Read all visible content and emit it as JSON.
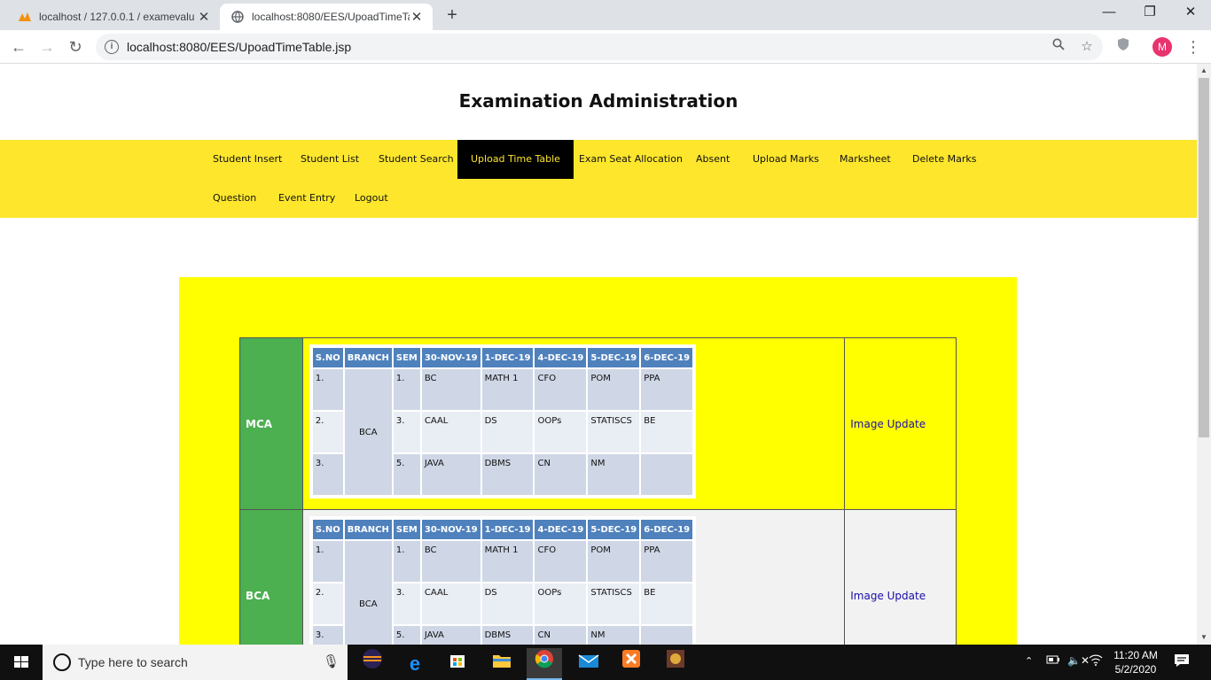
{
  "browser": {
    "tabs": [
      {
        "title": "localhost / 127.0.0.1 / examevalu",
        "favicon": "phpmyadmin-icon"
      },
      {
        "title": "localhost:8080/EES/UpoadTimeTa",
        "favicon": "globe-icon"
      }
    ],
    "url": "localhost:8080/EES/UpoadTimeTable.jsp",
    "profile_initial": "M"
  },
  "page": {
    "title": "Examination Administration",
    "nav": [
      "Student Insert",
      "Student List",
      "Student Search",
      "Upload Time Table",
      "Exam Seat Allocation",
      "Absent",
      "Upload Marks",
      "Marksheet",
      "Delete Marks",
      "Question",
      "Event Entry",
      "Logout"
    ],
    "active_nav": "Upload Time Table",
    "timetables": [
      {
        "program": "MCA",
        "headers": [
          "S.NO",
          "BRANCH",
          "SEM",
          "30-NOV-19",
          "1-DEC-19",
          "4-DEC-19",
          "5-DEC-19",
          "6-DEC-19"
        ],
        "branch": "BCA",
        "rows": [
          {
            "sno": "1.",
            "sem": "1.",
            "d1": "BC",
            "d2": "MATH 1",
            "d3": "CFO",
            "d4": "POM",
            "d5": "PPA"
          },
          {
            "sno": "2.",
            "sem": "3.",
            "d1": "CAAL",
            "d2": "DS",
            "d3": "OOPs",
            "d4": "STATISCS",
            "d5": "BE"
          },
          {
            "sno": "3.",
            "sem": "5.",
            "d1": "JAVA",
            "d2": "DBMS",
            "d3": "CN",
            "d4": "NM",
            "d5": ""
          }
        ],
        "link": "Image Update"
      },
      {
        "program": "BCA",
        "headers": [
          "S.NO",
          "BRANCH",
          "SEM",
          "30-NOV-19",
          "1-DEC-19",
          "4-DEC-19",
          "5-DEC-19",
          "6-DEC-19"
        ],
        "branch": "BCA",
        "rows": [
          {
            "sno": "1.",
            "sem": "1.",
            "d1": "BC",
            "d2": "MATH 1",
            "d3": "CFO",
            "d4": "POM",
            "d5": "PPA"
          },
          {
            "sno": "2.",
            "sem": "3.",
            "d1": "CAAL",
            "d2": "DS",
            "d3": "OOPs",
            "d4": "STATISCS",
            "d5": "BE"
          },
          {
            "sno": "3.",
            "sem": "5.",
            "d1": "JAVA",
            "d2": "DBMS",
            "d3": "CN",
            "d4": "NM",
            "d5": ""
          }
        ],
        "link": "Image Update"
      }
    ]
  },
  "taskbar": {
    "search_placeholder": "Type here to search",
    "time": "11:20 AM",
    "date": "5/2/2020"
  },
  "colors": {
    "nav_bg": "#fde62c",
    "content_bg": "#ffff00",
    "program_cell": "#4caf50",
    "table_header": "#4f81bd"
  }
}
